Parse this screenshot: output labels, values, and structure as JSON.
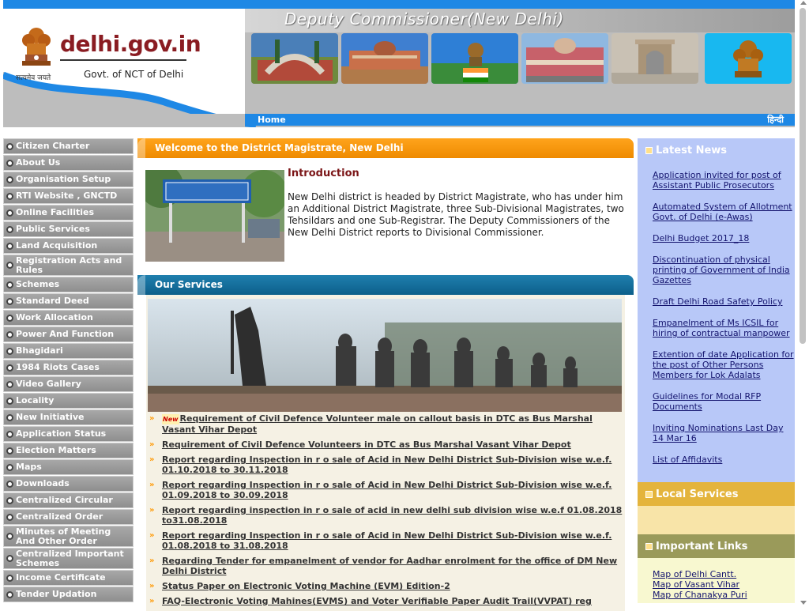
{
  "header": {
    "department_title": "Deputy Commissioner(New Delhi)",
    "site_name": "delhi.gov.in",
    "govt_label": "Govt. of NCT of Delhi",
    "motto": "सत्यमेव जयते",
    "nav_home": "Home",
    "nav_hindi": "हिन्दी",
    "accent_color": "#1e88e5"
  },
  "leftnav": {
    "items": [
      {
        "label": "Citizen Charter"
      },
      {
        "label": "About Us"
      },
      {
        "label": "Organisation Setup"
      },
      {
        "label": "RTI Website , GNCTD"
      },
      {
        "label": "Online Facilities"
      },
      {
        "label": "Public Services"
      },
      {
        "label": "Land Acquisition"
      },
      {
        "label": "Registration Acts and Rules"
      },
      {
        "label": "Schemes"
      },
      {
        "label": "Standard Deed"
      },
      {
        "label": "Work Allocation"
      },
      {
        "label": "Power And Function"
      },
      {
        "label": "Bhagidari"
      },
      {
        "label": "1984 Riots Cases"
      },
      {
        "label": "Video Gallery"
      },
      {
        "label": "Locality"
      },
      {
        "label": "New Initiative"
      },
      {
        "label": "Application Status"
      },
      {
        "label": "Election Matters"
      },
      {
        "label": "Maps"
      },
      {
        "label": "Downloads"
      },
      {
        "label": "Centralized Circular"
      },
      {
        "label": "Centralized Order"
      },
      {
        "label": "Minutes of Meeting And Other Order"
      },
      {
        "label": "Centralized Important Schemes"
      },
      {
        "label": "Income Certificate"
      },
      {
        "label": "Tender Updation"
      }
    ]
  },
  "welcome": {
    "heading": "Welcome to the District Magistrate, New Delhi",
    "intro_title": "Introduction",
    "intro_text": "New Delhi district is headed by District Magistrate, who has under him an Additional District Magistrate, three Sub-Divisional Magistrates, two Tehsildars and one Sub-Registrar. The Deputy Commissioners of the New Delhi District reports to Divisional Commissioner."
  },
  "services": {
    "heading": "Our Services",
    "new_badge": "New",
    "items": [
      {
        "text": "Requirement of Civil Defence Volunteer male on callout basis in DTC as Bus Marshal Vasant Vihar Depot",
        "is_new": true
      },
      {
        "text": "Requirement of Civil Defence Volunteers in DTC as Bus Marshal Vasant Vihar Depot"
      },
      {
        "text": "Report regarding Inspection in r o sale of Acid in New Delhi District Sub-Division wise w.e.f. 01.10.2018 to 30.11.2018"
      },
      {
        "text": "Report regarding Inspection in r o sale of Acid in New Delhi District Sub-Division wise w.e.f. 01.09.2018 to 30.09.2018"
      },
      {
        "text": "Report regarding inspection in r o sale of acid in new delhi sub division wise w.e.f 01.08.2018 to31.08.2018"
      },
      {
        "text": "Report regarding Inspection in r o sale of Acid in New Delhi District Sub-Division wise w.e.f. 01.08.2018 to 31.08.2018"
      },
      {
        "text": "Regarding Tender for empanelment of vendor for Aadhar enrolment for the office of DM New Delhi District"
      },
      {
        "text": "Status Paper on Electronic Voting Machine (EVM) Edition-2"
      },
      {
        "text": "FAQ-Electronic Voting Mahines(EVMS) and Voter Verifiable Paper Audit Trail(VVPAT) reg"
      }
    ]
  },
  "latest_news": {
    "heading": "Latest News",
    "items": [
      "Application invited for post of Assistant Public Prosecutors",
      "Automated System of Allotment Govt. of Delhi (e-Awas)",
      "Delhi Budget 2017_18",
      "Discontinuation of physical printing of Government of India Gazettes",
      "Draft Delhi Road Safety Policy",
      "Empanelment of Ms ICSIL for hiring of contractual manpower",
      "Extention of date Application for the post of Other Persons Members for Lok Adalats",
      "Guidelines for Modal RFP Documents",
      "Inviting Nominations Last Day 14 Mar 16",
      "List of Affidavits"
    ]
  },
  "local_services": {
    "heading": "Local Services"
  },
  "important_links": {
    "heading": "Important Links",
    "items": [
      "Map of Delhi Cantt.",
      "Map of Vasant Vihar",
      "Map of Chanakya Puri"
    ]
  }
}
